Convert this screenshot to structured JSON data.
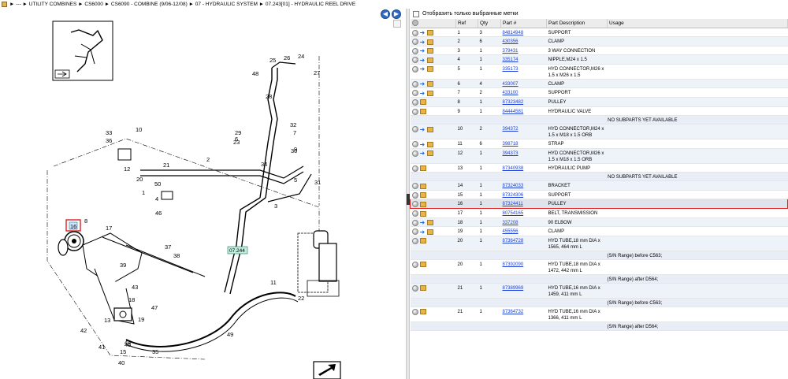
{
  "breadcrumb": {
    "items": [
      "---",
      "UTILITY COMBINES",
      "CS6000",
      "CS6090 - COMBINE (9/06-12/08)",
      "07 - HYDRAULIC SYSTEM",
      "07.243[01] - HYDRAULIC REEL DRIVE"
    ],
    "separator": "►"
  },
  "nav": {
    "back_icon": "arrow-left-icon",
    "forward_icon": "arrow-right-icon"
  },
  "diagram": {
    "callouts": [
      "1",
      "2",
      "3",
      "4",
      "5",
      "6",
      "7",
      "8",
      "9",
      "10",
      "11",
      "12",
      "13",
      "15",
      "16",
      "17",
      "18",
      "19",
      "20",
      "21",
      "22",
      "23",
      "24",
      "25",
      "26",
      "27",
      "28",
      "29",
      "30",
      "31",
      "32",
      "33",
      "34",
      "35",
      "36",
      "37",
      "38",
      "39",
      "40",
      "41",
      "42",
      "43",
      "44",
      "45",
      "46",
      "47",
      "48",
      "49",
      "50"
    ],
    "highlight_ref": "16",
    "ref_tag": "07.244"
  },
  "filter": {
    "label": "Отобразить только выбранные метки"
  },
  "table": {
    "headers": [
      "",
      "Ref",
      "Qty",
      "Part #",
      "Part Description",
      "Usage"
    ],
    "rows": [
      {
        "ref": "1",
        "qty": "3",
        "part": "84814948",
        "desc": "SUPPORT",
        "swap": true
      },
      {
        "ref": "2",
        "qty": "6",
        "part": "430356",
        "desc": "CLAMP",
        "swap": true
      },
      {
        "ref": "3",
        "qty": "1",
        "part": "379431",
        "desc": "3 WAY CONNECTION",
        "swap": true
      },
      {
        "ref": "4",
        "qty": "1",
        "part": "335174",
        "desc": "NIPPLE,M24 x 1.5",
        "swap": true
      },
      {
        "ref": "5",
        "qty": "1",
        "part": "335173",
        "desc": "HYD CONNECTOR,M26 x 1.5  x M26 x 1.5",
        "swap": true
      },
      {
        "ref": "6",
        "qty": "4",
        "part": "433007",
        "desc": "CLAMP",
        "swap": true
      },
      {
        "ref": "7",
        "qty": "2",
        "part": "433100",
        "desc": "SUPPORT",
        "swap": true
      },
      {
        "ref": "8",
        "qty": "1",
        "part": "87323482",
        "desc": "PULLEY",
        "swap": false
      },
      {
        "ref": "9",
        "qty": "1",
        "part": "84444581",
        "desc": "HYDRAULIC VALVE",
        "swap": false
      },
      {
        "note": "NO SUBPARTS YET AVAILABLE"
      },
      {
        "ref": "10",
        "qty": "2",
        "part": "394372",
        "desc": "HYD CONNECTOR,M24 x 1.5  x M18 x 1.5 ORB",
        "swap": true
      },
      {
        "ref": "11",
        "qty": "6",
        "part": "398718",
        "desc": "STRAP",
        "swap": true
      },
      {
        "ref": "12",
        "qty": "1",
        "part": "394373",
        "desc": "HYD CONNECTOR,M26 x 1.5  x M18 x 1.5 ORB",
        "swap": true
      },
      {
        "ref": "13",
        "qty": "1",
        "part": "87340938",
        "desc": "HYDRAULIC PUMP",
        "swap": false
      },
      {
        "note": "NO SUBPARTS YET AVAILABLE"
      },
      {
        "ref": "14",
        "qty": "1",
        "part": "87324033",
        "desc": "BRACKET",
        "swap": false
      },
      {
        "ref": "15",
        "qty": "1",
        "part": "87324306",
        "desc": "SUPPORT",
        "swap": false
      },
      {
        "ref": "16",
        "qty": "1",
        "part": "87324411",
        "desc": "PULLEY",
        "swap": false,
        "selected": true
      },
      {
        "ref": "17",
        "qty": "1",
        "part": "80754165",
        "desc": "BELT, TRANSMISSION",
        "swap": false
      },
      {
        "ref": "18",
        "qty": "1",
        "part": "337208",
        "desc": "90 ELBOW",
        "swap": true
      },
      {
        "ref": "19",
        "qty": "1",
        "part": "455556",
        "desc": "CLAMP",
        "swap": true
      },
      {
        "ref": "20",
        "qty": "1",
        "part": "87364728",
        "desc": "HYD TUBE,18 mm DIA x 1565, 464 mm L",
        "swap": false
      },
      {
        "note": "(S/N Range) before C563;",
        "left": true
      },
      {
        "ref": "20",
        "qty": "1",
        "part": "87392090",
        "desc": "HYD TUBE,18 mm DIA x 1472, 442 mm L",
        "swap": false
      },
      {
        "note": "(S/N Range) after D564;",
        "left": true
      },
      {
        "ref": "21",
        "qty": "1",
        "part": "87389969",
        "desc": "HYD TUBE,16 mm DIA x 1459, 411 mm L",
        "swap": false
      },
      {
        "note": "(S/N Range) before C563;",
        "left": true
      },
      {
        "ref": "21",
        "qty": "1",
        "part": "87364732",
        "desc": "HYD TUBE,16 mm DIA x 1366, 411 mm L",
        "swap": false
      },
      {
        "note": "(S/N Range) after D564;",
        "left": true
      }
    ]
  }
}
